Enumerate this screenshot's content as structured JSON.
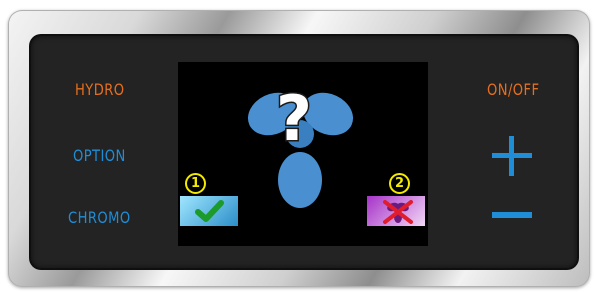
{
  "controls": {
    "hydro_label": "HYDRO",
    "option_label": "OPTION",
    "chromo_label": "CHROMO",
    "onoff_label": "ON/OFF"
  },
  "screen": {
    "status_left_number": "1",
    "status_right_number": "2",
    "fan_icon": "fan-icon",
    "question_icon": "question-mark-icon",
    "check_icon": "check-icon",
    "fan_off_icon": "fan-off-icon"
  },
  "colors": {
    "accent_orange": "#e56f1f",
    "accent_blue": "#1f8ed6",
    "badge_yellow": "#f2ea00",
    "panel_bg": "#232323",
    "screen_bg": "#000000"
  }
}
